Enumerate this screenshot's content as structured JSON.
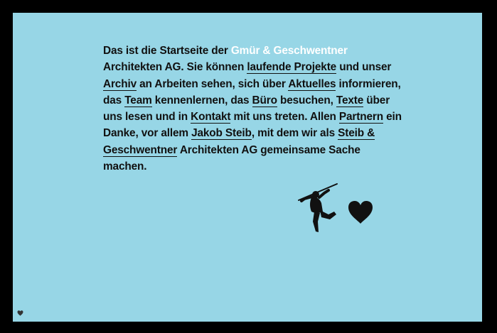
{
  "intro": {
    "t0": "Das ist die Startseite der ",
    "brand": "Gmür & Geschwentner",
    "t1": " Architekten AG. Sie können ",
    "link_projekte": "laufende Projekte",
    "t2": " und unser ",
    "link_archiv": "Archiv",
    "t3": " an Arbeiten sehen, sich über ",
    "link_aktuelles": "Aktuelles",
    "t4": " informieren, das ",
    "link_team": "Team",
    "t5": " kennenlernen, das ",
    "link_buero": "Büro",
    "t6": " besuchen, ",
    "link_texte": "Texte",
    "t7": " über uns lesen und in ",
    "link_kontakt": "Kontakt",
    "t8": " mit uns treten. Allen ",
    "link_partnern": "Partnern",
    "t9": " ein Danke, vor allem ",
    "link_steib": "Jakob Steib",
    "t10": ", mit dem wir als ",
    "link_steib_gesch": "Steib & Geschwentner",
    "t11": " Architekten AG gemeinsame Sache machen."
  },
  "colors": {
    "background": "#97d6e6",
    "frame": "#000000",
    "text": "#111111",
    "brand": "#ffffff"
  },
  "icons": {
    "figure": "climber-silhouette-icon",
    "heart": "heart-icon",
    "corner": "small-heart-icon"
  }
}
